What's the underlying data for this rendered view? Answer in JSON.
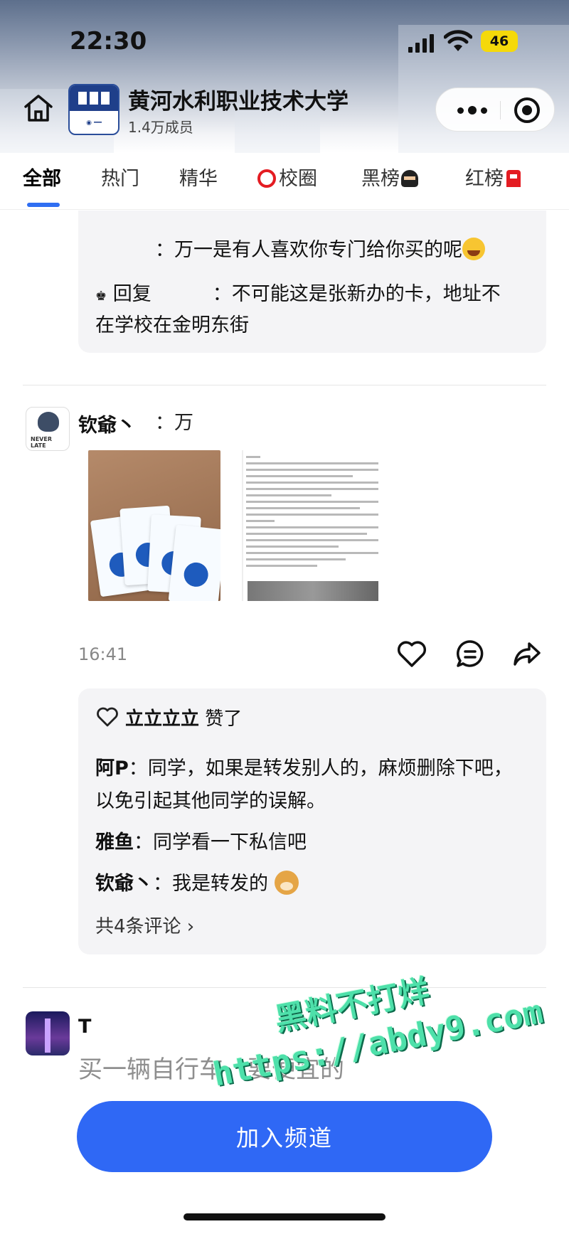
{
  "status_bar": {
    "time": "22:30",
    "battery": "46"
  },
  "channel": {
    "name": "黄河水利职业技术大学",
    "members": "1.4万成员"
  },
  "tabs": [
    {
      "label": "全部"
    },
    {
      "label": "热门"
    },
    {
      "label": "精华"
    },
    {
      "label": "校圈"
    },
    {
      "label": "黑榜"
    },
    {
      "label": "红榜"
    }
  ],
  "top_comments": {
    "line1": "：万一是有人喜欢你专门给你买的呢",
    "reply_prefix": "回复",
    "line2": "：不可能这是张新办的卡，地址不",
    "line3": "在学校在金明东街"
  },
  "post": {
    "author": "钦爺丶",
    "author_extra": "：万",
    "time": "16:41",
    "likes": {
      "user": "立立立立",
      "suffix": "赞了"
    },
    "comments": [
      {
        "user": "阿P",
        "text": "：同学，如果是转发别人的，麻烦删除下吧，以免引起其他同学的误解。"
      },
      {
        "user": "雅鱼",
        "text": "：同学看一下私信吧"
      },
      {
        "user": "钦爺丶",
        "text": "：我是转发的"
      }
    ],
    "total_comments": "共4条评论 ›"
  },
  "post2": {
    "author": "T",
    "text": "买一辆自行车，要便宜的"
  },
  "watermark": {
    "line1": "黑料不打烊",
    "line2": "https://abdy9.com"
  },
  "join_button": "加入频道",
  "icons": [
    "home-icon",
    "more-icon",
    "close-icon",
    "heart-icon",
    "comment-icon",
    "share-icon",
    "chevron-right-icon"
  ],
  "colors": {
    "accent": "#2f68f5",
    "tab_indicator": "#2f6ef2",
    "watermark": "#4ee0aa"
  }
}
